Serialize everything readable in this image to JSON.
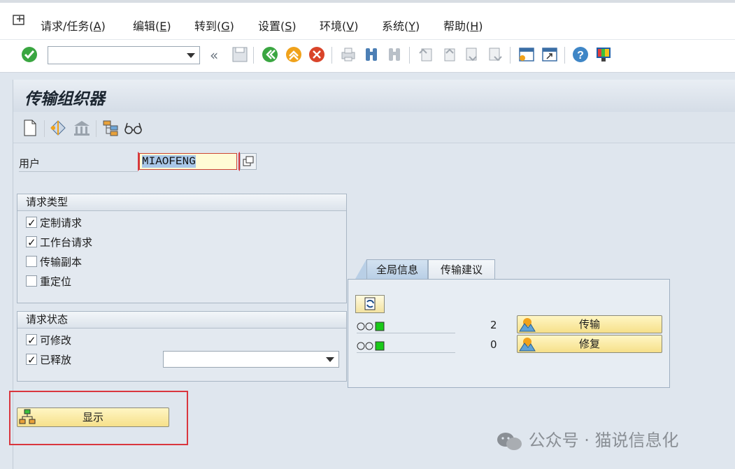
{
  "menu": [
    {
      "label": "请求/任务(",
      "key": "A",
      "tail": ")"
    },
    {
      "label": "编辑(",
      "key": "E",
      "tail": ")"
    },
    {
      "label": "转到(",
      "key": "G",
      "tail": ")"
    },
    {
      "label": "设置(",
      "key": "S",
      "tail": ")"
    },
    {
      "label": "环境(",
      "key": "V",
      "tail": ")"
    },
    {
      "label": "系统(",
      "key": "Y",
      "tail": ")"
    },
    {
      "label": "帮助(",
      "key": "H",
      "tail": ")"
    }
  ],
  "toolbar": {
    "command_value": "",
    "overflow_glyph": "«"
  },
  "title": "传输组织器",
  "user": {
    "label": "用户",
    "value": "MIAOFENG"
  },
  "request_type": {
    "title": "请求类型",
    "items": [
      {
        "label": "定制请求",
        "checked": true
      },
      {
        "label": "工作台请求",
        "checked": true
      },
      {
        "label": "传输副本",
        "checked": false
      },
      {
        "label": "重定位",
        "checked": false
      }
    ]
  },
  "request_status": {
    "title": "请求状态",
    "items": [
      {
        "label": "可修改",
        "checked": true
      },
      {
        "label": "已释放",
        "checked": true
      }
    ],
    "released_select_value": ""
  },
  "tabs": [
    {
      "label": "全局信息",
      "active": true
    },
    {
      "label": "传输建议",
      "active": false
    }
  ],
  "global_info": {
    "rows": [
      {
        "count": "2",
        "button": "传输"
      },
      {
        "count": "0",
        "button": "修复"
      }
    ]
  },
  "display_button": "显示",
  "watermark": "公众号 · 猫说信息化",
  "colors": {
    "accent_yellow": "#f6e08a",
    "highlight_red": "#d9363e",
    "lamp_green": "#19c919"
  }
}
